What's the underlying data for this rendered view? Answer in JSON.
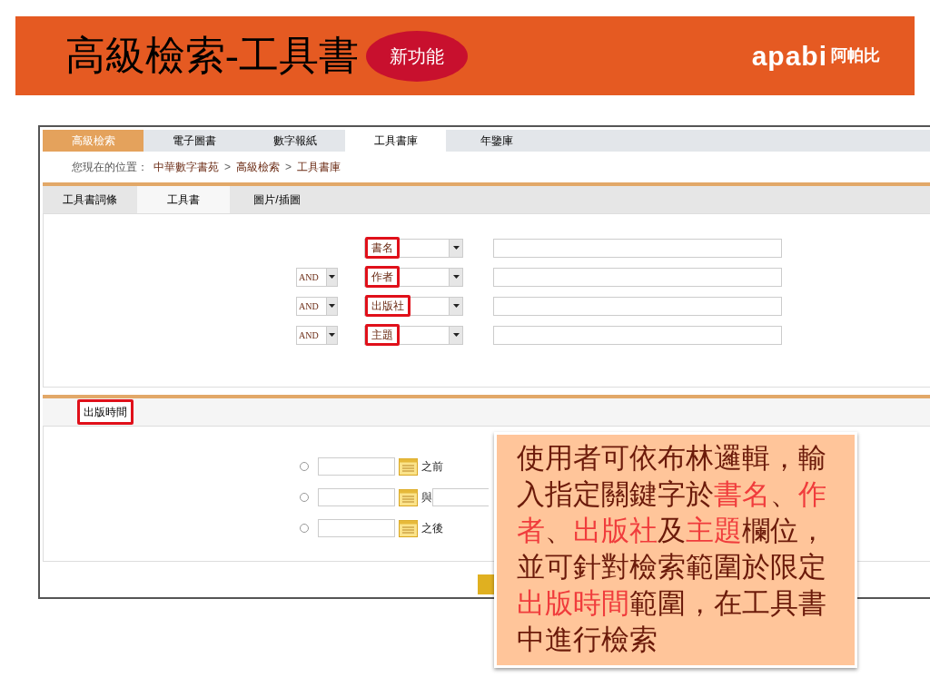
{
  "header": {
    "title": "高級檢索-工具書",
    "badge": "新功能",
    "logo_latin": "apabi",
    "logo_cjk": "阿帕比"
  },
  "nav_tabs": [
    {
      "label": "高級檢索",
      "kind": "accent",
      "selected": false
    },
    {
      "label": "電子圖書",
      "kind": "tab",
      "selected": false
    },
    {
      "label": "數字報紙",
      "kind": "tab",
      "selected": false
    },
    {
      "label": "工具書庫",
      "kind": "tab",
      "selected": true
    },
    {
      "label": "年鑒庫",
      "kind": "tab",
      "selected": false
    }
  ],
  "breadcrumb": {
    "label": "您現在的位置：",
    "items": [
      {
        "text": "中華數字書苑",
        "kind": "link"
      },
      {
        "text": ">",
        "kind": "separator"
      },
      {
        "text": "高級檢索",
        "kind": "link"
      },
      {
        "text": ">",
        "kind": "separator"
      },
      {
        "text": "工具書庫",
        "kind": "link"
      }
    ]
  },
  "sub_tabs": [
    {
      "label": "工具書詞條",
      "selected": false
    },
    {
      "label": "工具書",
      "selected": true
    },
    {
      "label": "圖片/插圖",
      "selected": false
    }
  ],
  "search_rows": [
    {
      "field": "書名",
      "highlighted": true
    },
    {
      "operator": "AND",
      "field": "作者",
      "highlighted": true
    },
    {
      "operator": "AND",
      "field": "出版社",
      "highlighted": true
    },
    {
      "operator": "AND",
      "field": "主題",
      "highlighted": true
    }
  ],
  "date_section": {
    "title": "出版時間",
    "highlighted": true,
    "options": [
      {
        "kind": "single",
        "selected": false,
        "label": "之前"
      },
      {
        "kind": "range",
        "selected": false,
        "label": "與"
      },
      {
        "kind": "single",
        "selected": false,
        "label": "之後"
      }
    ]
  },
  "callout": {
    "segments": [
      {
        "text": "使用者可依布林邏輯，輸入指定關鍵字於",
        "emphasis": false
      },
      {
        "text": "書名",
        "emphasis": true
      },
      {
        "text": "、",
        "emphasis": false
      },
      {
        "text": "作者",
        "emphasis": true
      },
      {
        "text": "、",
        "emphasis": false
      },
      {
        "text": "出版社",
        "emphasis": true
      },
      {
        "text": "及",
        "emphasis": false
      },
      {
        "text": "主題",
        "emphasis": true
      },
      {
        "text": "欄位，並可針對檢索範圍於限定",
        "emphasis": false
      },
      {
        "text": "出版時間",
        "emphasis": true
      },
      {
        "text": "範圍，在工具書中進行檢索",
        "emphasis": false
      }
    ]
  }
}
